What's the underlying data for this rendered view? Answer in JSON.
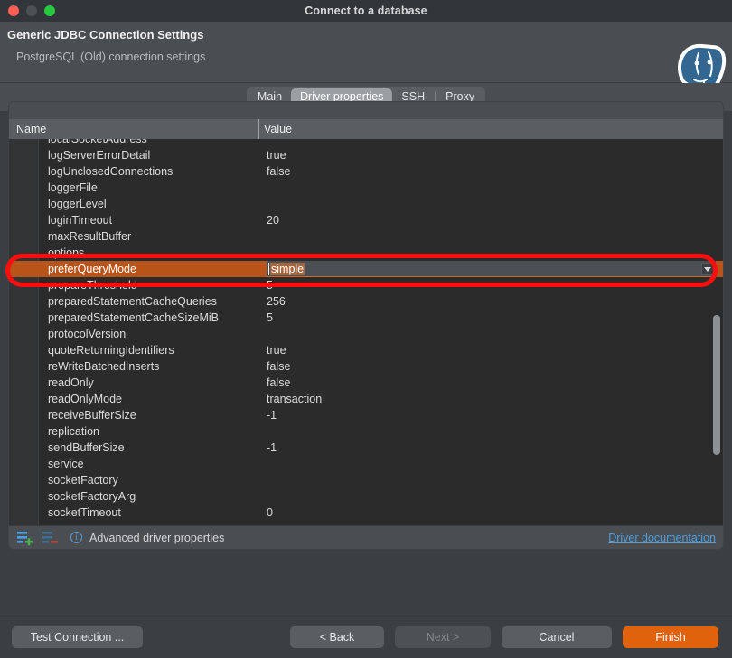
{
  "window": {
    "title": "Connect to a database",
    "traffic_lights": [
      "close-button",
      "minimize-button",
      "maximize-button"
    ]
  },
  "header": {
    "title": "Generic JDBC Connection Settings",
    "subtitle": "PostgreSQL (Old) connection settings",
    "logo": "postgresql-elephant-logo"
  },
  "tabs": [
    {
      "label": "Main",
      "active": false
    },
    {
      "label": "Driver properties",
      "active": true
    },
    {
      "label": "SSH",
      "active": false
    },
    {
      "label": "Proxy",
      "active": false
    }
  ],
  "table": {
    "columns": [
      "Name",
      "Value"
    ],
    "rows": [
      {
        "name": "localSocketAddress",
        "value": ""
      },
      {
        "name": "logServerErrorDetail",
        "value": "true"
      },
      {
        "name": "logUnclosedConnections",
        "value": "false"
      },
      {
        "name": "loggerFile",
        "value": ""
      },
      {
        "name": "loggerLevel",
        "value": ""
      },
      {
        "name": "loginTimeout",
        "value": "20"
      },
      {
        "name": "maxResultBuffer",
        "value": ""
      },
      {
        "name": "options",
        "value": ""
      },
      {
        "name": "preferQueryMode",
        "value": "simple",
        "selected": true,
        "editing": true
      },
      {
        "name": "prepareThreshold",
        "value": "5"
      },
      {
        "name": "preparedStatementCacheQueries",
        "value": "256"
      },
      {
        "name": "preparedStatementCacheSizeMiB",
        "value": "5"
      },
      {
        "name": "protocolVersion",
        "value": ""
      },
      {
        "name": "quoteReturningIdentifiers",
        "value": "true"
      },
      {
        "name": "reWriteBatchedInserts",
        "value": "false"
      },
      {
        "name": "readOnly",
        "value": "false"
      },
      {
        "name": "readOnlyMode",
        "value": "transaction"
      },
      {
        "name": "receiveBufferSize",
        "value": "-1"
      },
      {
        "name": "replication",
        "value": ""
      },
      {
        "name": "sendBufferSize",
        "value": "-1"
      },
      {
        "name": "service",
        "value": ""
      },
      {
        "name": "socketFactory",
        "value": ""
      },
      {
        "name": "socketFactoryArg",
        "value": ""
      },
      {
        "name": "socketTimeout",
        "value": "0"
      },
      {
        "name": "",
        "value": ""
      }
    ]
  },
  "editor": {
    "value": "simple"
  },
  "panel_footer": {
    "add_icon": "add-property-icon",
    "remove_icon": "remove-property-icon",
    "info_icon": "info-icon",
    "info_glyph": "i",
    "label": "Advanced driver properties",
    "doc_link": "Driver documentation"
  },
  "buttons": {
    "test": "Test Connection ...",
    "back": "< Back",
    "next": "Next >",
    "cancel": "Cancel",
    "finish": "Finish"
  },
  "colors": {
    "accent": "#e0620d",
    "selection": "#b8531a",
    "annotation": "#fd0d0d",
    "link": "#4e9fdc"
  }
}
